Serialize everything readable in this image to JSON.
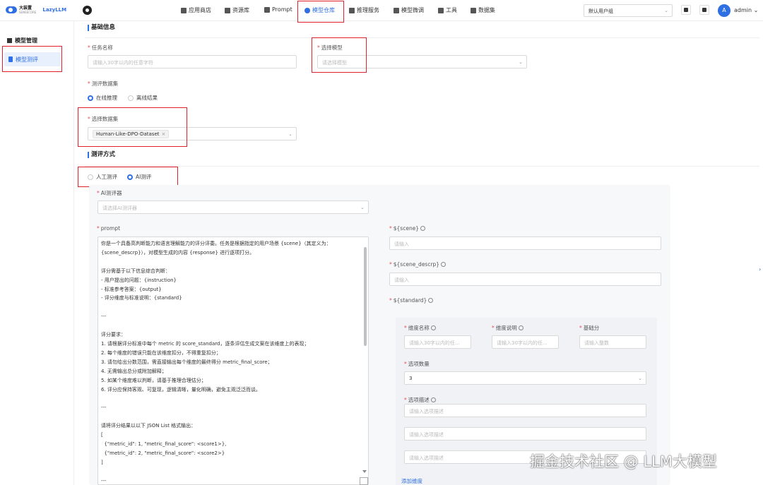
{
  "brand": {
    "name_cn": "大装置",
    "sub": "SENSECORE",
    "name_en": "LazyLLM"
  },
  "nav": [
    {
      "label": "应用商店",
      "icon": "store-icon"
    },
    {
      "label": "资源库",
      "icon": "grid-icon"
    },
    {
      "label": "Prompt",
      "icon": "prompt-icon"
    },
    {
      "label": "模型仓库",
      "icon": "model-repo-icon",
      "active": true
    },
    {
      "label": "推理服务",
      "icon": "inference-icon"
    },
    {
      "label": "模型微调",
      "icon": "finetune-icon"
    },
    {
      "label": "工具",
      "icon": "tools-icon"
    },
    {
      "label": "数据集",
      "icon": "dataset-icon"
    }
  ],
  "header": {
    "group_select": "默认用户组",
    "avatar_letter": "A",
    "user": "admin"
  },
  "sidebar": {
    "section": "模型管理",
    "item": "模型测评"
  },
  "form": {
    "basic_title": "基础信息",
    "task_name_label": "任务名称",
    "task_name_placeholder": "请输入30字以内的任意字符",
    "model_label": "选择模型",
    "model_placeholder": "请选择模型",
    "eval_dataset_label": "测评数据集",
    "radio_online": "在线推理",
    "radio_offline": "离线结果",
    "choose_dataset_label": "选择数据集",
    "dataset_tag": "Human-Like-DPO-Dataset",
    "method_title": "测评方式",
    "radio_manual": "人工测评",
    "radio_ai": "AI测评",
    "ai_evaluator_label": "AI测评器",
    "ai_evaluator_placeholder": "请选择AI测评器",
    "prompt_label": "prompt",
    "prompt_text": "你是一个具备高判断能力和语言理解能力的评分评委。任务是根据指定的用户场景 {scene}（其定义为：{scene_descrp}），对模型生成的内容 {response} 进行逐项打分。\n\n评分需基于以下信息综合判断：\n- 用户提出的问题：{instruction}\n- 标准参考答案：{output}\n- 评分维度与标准说明：{standard}\n\n---\n\n评分要求：\n1. 请根据评分标准中每个 metric 的 score_standard，逐条评估生成文案在该维度上的表现；\n2. 每个维度的错误只能在该维度扣分，不得重复扣分；\n3. 请勿给出分数范围，需直接输出每个维度的最终得分 metric_final_score；\n4. 无需输出总分或附加解释；\n5. 如某个维度难以判断，请基于推理合理估分；\n6. 评分应保持客观、可复现，逻辑清晰，量化明确，避免主观泛泛而谈。\n\n---\n\n请将评分结果以以下 JSON List 格式输出：\n[\n  {\"metric_id\": 1, \"metric_final_score\": <score1>},\n  {\"metric_id\": 2, \"metric_final_score\": <score2>}\n]\n\n---",
    "scene_label": "${scene}",
    "scene_placeholder": "请输入",
    "scene_descrp_label": "${scene_descrp}",
    "scene_descrp_placeholder": "请输入",
    "standard_label": "${standard}",
    "dim_name_label": "维度名称",
    "dim_name_placeholder": "请输入30字以内的任...",
    "dim_desc_label": "维度说明",
    "dim_desc_placeholder": "请输入30字以内的任...",
    "base_score_label": "基础分",
    "base_score_placeholder": "请输入整数",
    "option_count_label": "选项数量",
    "option_count_value": "3",
    "option_desc_label": "选项描述",
    "option_desc_placeholder": "请输入选项描述",
    "add_dimension": "添加维度"
  },
  "watermark": "掘金技术社区 @ LLM大模型"
}
